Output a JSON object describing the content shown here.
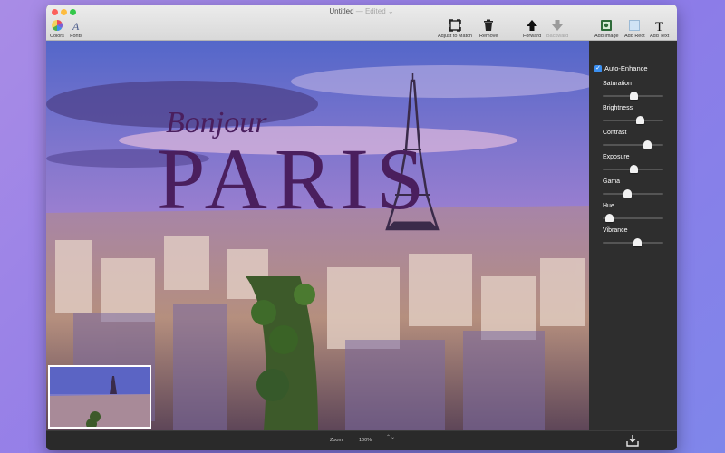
{
  "window": {
    "title": "Untitled",
    "title_status": "— Edited ⌄"
  },
  "toolbar": {
    "colors_label": "Colors",
    "fonts_label": "Fonts",
    "adjust_label": "Adjust to Match",
    "remove_label": "Remove",
    "forward_label": "Forward",
    "backward_label": "Backward",
    "add_image_label": "Add Image",
    "add_rect_label": "Add Rect",
    "add_text_label": "Add Text"
  },
  "canvas": {
    "script_text": "Bonjour",
    "big_text": "PARIS",
    "text_color": "#4a1f5e"
  },
  "panel": {
    "auto_enhance_label": "Auto-Enhance",
    "auto_enhance_checked": true,
    "sliders": [
      {
        "label": "Saturation",
        "value": 0.52
      },
      {
        "label": "Brightness",
        "value": 0.64
      },
      {
        "label": "Contrast",
        "value": 0.78
      },
      {
        "label": "Exposure",
        "value": 0.52
      },
      {
        "label": "Gama",
        "value": 0.4
      },
      {
        "label": "Hue",
        "value": 0.05
      },
      {
        "label": "Vibrance",
        "value": 0.58
      }
    ]
  },
  "status": {
    "zoom_label": "Zoom:",
    "zoom_value": "100%",
    "zoom_stepper": "⌃⌄"
  },
  "colors": {
    "accent": "#3b8ff0",
    "panel_bg": "#2e2e2e"
  }
}
